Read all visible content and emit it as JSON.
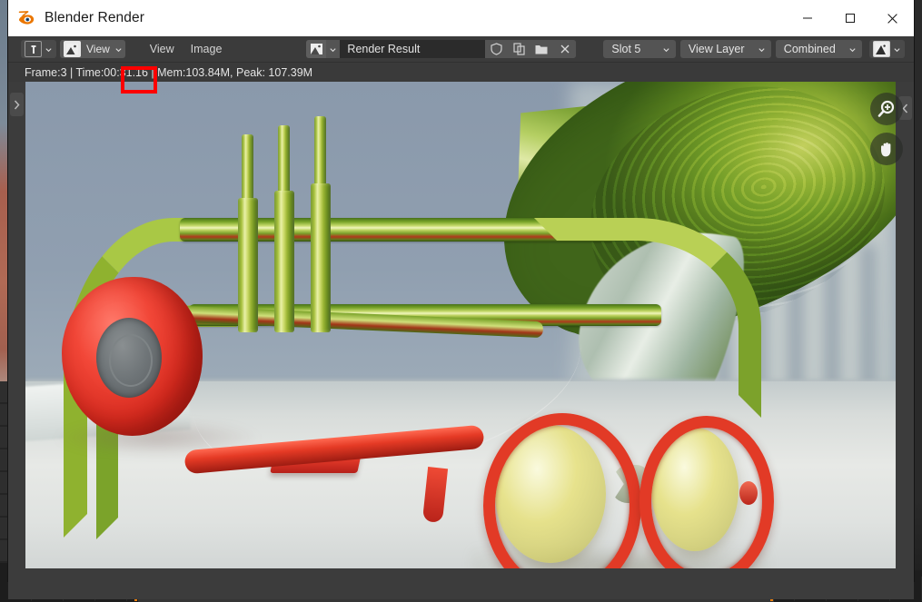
{
  "window": {
    "title": "Blender Render",
    "logo_icon": "blender-logo-icon",
    "controls": {
      "minimize": "minimize-icon",
      "maximize": "maximize-icon",
      "close": "close-icon"
    }
  },
  "toolbar": {
    "editor_type_icon": "image-editor-icon",
    "editor_type_chevron": "chevron-down-icon",
    "display_mode": {
      "icon": "image-icon",
      "label": "View",
      "chevron": "chevron-down-icon"
    },
    "menus": [
      {
        "label": "View"
      },
      {
        "label": "Image"
      }
    ],
    "datablock": {
      "icon": "image-datablock-icon",
      "chevron": "chevron-down-icon",
      "name": "Render Result",
      "ops": [
        {
          "name": "fake-user-shield-icon"
        },
        {
          "name": "new-image-copy-icon"
        },
        {
          "name": "open-folder-icon"
        },
        {
          "name": "unlink-close-icon"
        }
      ]
    },
    "slot": {
      "label": "Slot 5",
      "chevron": "chevron-down-icon"
    },
    "view_layer": {
      "label": "View Layer",
      "chevron": "chevron-down-icon"
    },
    "pass": {
      "label": "Combined",
      "chevron": "chevron-down-icon"
    },
    "display_channels": {
      "icon": "display-channels-icon",
      "chevron": "chevron-down-icon"
    }
  },
  "status": {
    "text": "Frame:3 | Time:00:31.16 | Mem:103.84M, Peak: 107.39M",
    "frame": "3",
    "time": "00:31.16",
    "memory": "103.84M",
    "peak": "107.39M",
    "annotation_color": "#fe0000"
  },
  "canvas": {
    "zoom_gizmo": "zoom-in-icon",
    "pan_gizmo": "pan-hand-icon",
    "left_sidebar_tab": "chevron-right-icon",
    "right_sidebar_tab": "chevron-left-icon",
    "scene_description": "Rendered 3D scene: brass trumpet with red tape reel and red-framed round sunglasses with yellow lenses on a white table"
  },
  "colors": {
    "accent_orange": "#e87d0d",
    "accent_blue": "#4772b3",
    "toolbar_bg": "#3b3b3b",
    "titlebar_bg": "#ffffff"
  }
}
